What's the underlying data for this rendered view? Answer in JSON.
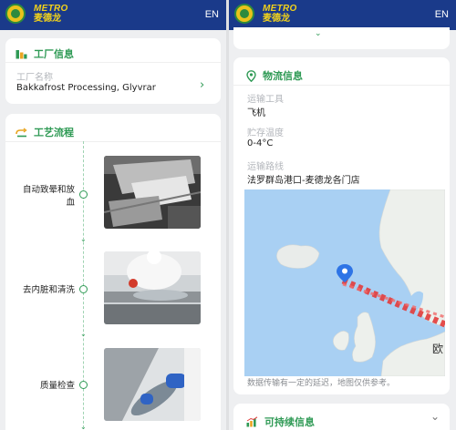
{
  "header": {
    "logo_en": "METRO",
    "logo_cn": "麦德龙",
    "lang": "EN"
  },
  "factory": {
    "title": "工厂信息",
    "name_label": "工厂名称",
    "name_value": "Bakkafrost Processing, Glyvrar"
  },
  "process": {
    "title": "工艺流程",
    "steps": [
      {
        "label": "自动致晕和放血"
      },
      {
        "label": "去内脏和清洗"
      },
      {
        "label": "质量检查"
      }
    ]
  },
  "logistics": {
    "title": "物流信息",
    "transport_label": "运输工具",
    "transport_value": "飞机",
    "temp_label": "贮存温度",
    "temp_value": "0-4°C",
    "route_label": "运输路线",
    "route_value": "法罗群岛港口-麦德龙各门店",
    "map_note": "数据传输有一定的延迟，地图仅供参考。",
    "map_continent_label": "欧"
  },
  "sustainability": {
    "title": "可持续信息"
  },
  "colors": {
    "header": "#1a3a8a",
    "accent": "#2f9a55",
    "logo": "#f2d21a",
    "route": "#e23b3b"
  }
}
